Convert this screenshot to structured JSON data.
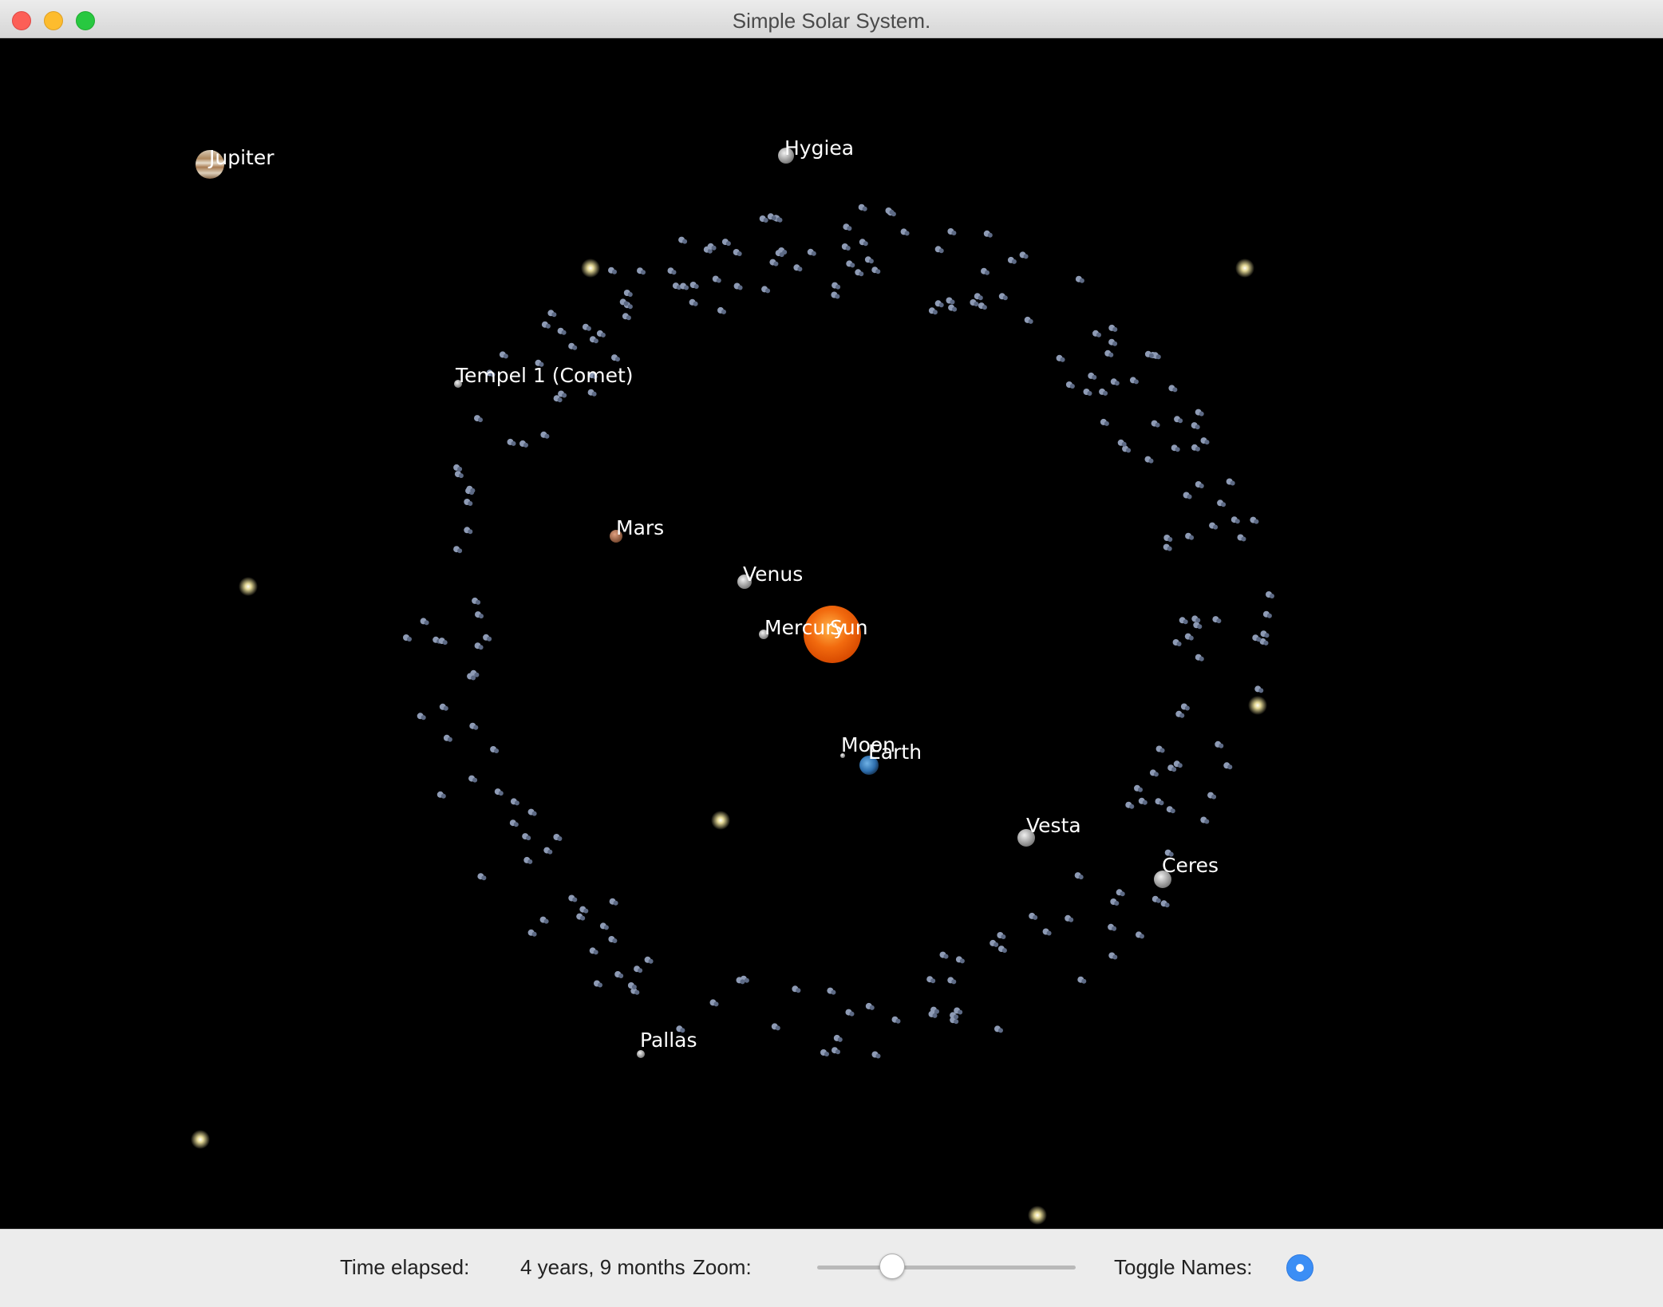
{
  "window": {
    "title": "Simple Solar System."
  },
  "bodies": [
    {
      "id": "sun",
      "label": "Sun",
      "kind": "star",
      "color": "#f26a0e"
    },
    {
      "id": "mercury",
      "label": "Mercury",
      "kind": "planet",
      "color": "#8a8a8a"
    },
    {
      "id": "venus",
      "label": "Venus",
      "kind": "planet",
      "color": "#d9d2c0"
    },
    {
      "id": "earth",
      "label": "Earth",
      "kind": "planet",
      "color": "#2e6fae"
    },
    {
      "id": "moon",
      "label": "Moon",
      "kind": "moon",
      "color": "#9a9a9a"
    },
    {
      "id": "mars",
      "label": "Mars",
      "kind": "planet",
      "color": "#b07050"
    },
    {
      "id": "jupiter",
      "label": "Jupiter",
      "kind": "planet",
      "color": "#c9b79c"
    },
    {
      "id": "vesta",
      "label": "Vesta",
      "kind": "asteroid",
      "color": "#a9a9a9"
    },
    {
      "id": "ceres",
      "label": "Ceres",
      "kind": "asteroid",
      "color": "#a9a9a9"
    },
    {
      "id": "pallas",
      "label": "Pallas",
      "kind": "asteroid",
      "color": "#a9a9a9"
    },
    {
      "id": "hygiea",
      "label": "Hygiea",
      "kind": "asteroid",
      "color": "#b5b5b5"
    },
    {
      "id": "tempel",
      "label": "Tempel 1 (Comet)",
      "kind": "comet",
      "color": "#8c8c8c"
    }
  ],
  "controls": {
    "time_label": "Time elapsed:",
    "time_value": "4 years, 9 months",
    "zoom_label": "Zoom:",
    "zoom_value": 0.29,
    "names_label": "Toggle Names:",
    "names_on": true
  },
  "colors": {
    "background": "#000000",
    "label": "#ffffff",
    "star_glow": "#fff2a8",
    "asteroid": "#8e9bb5",
    "toggle_accent": "#3b8ef5"
  }
}
